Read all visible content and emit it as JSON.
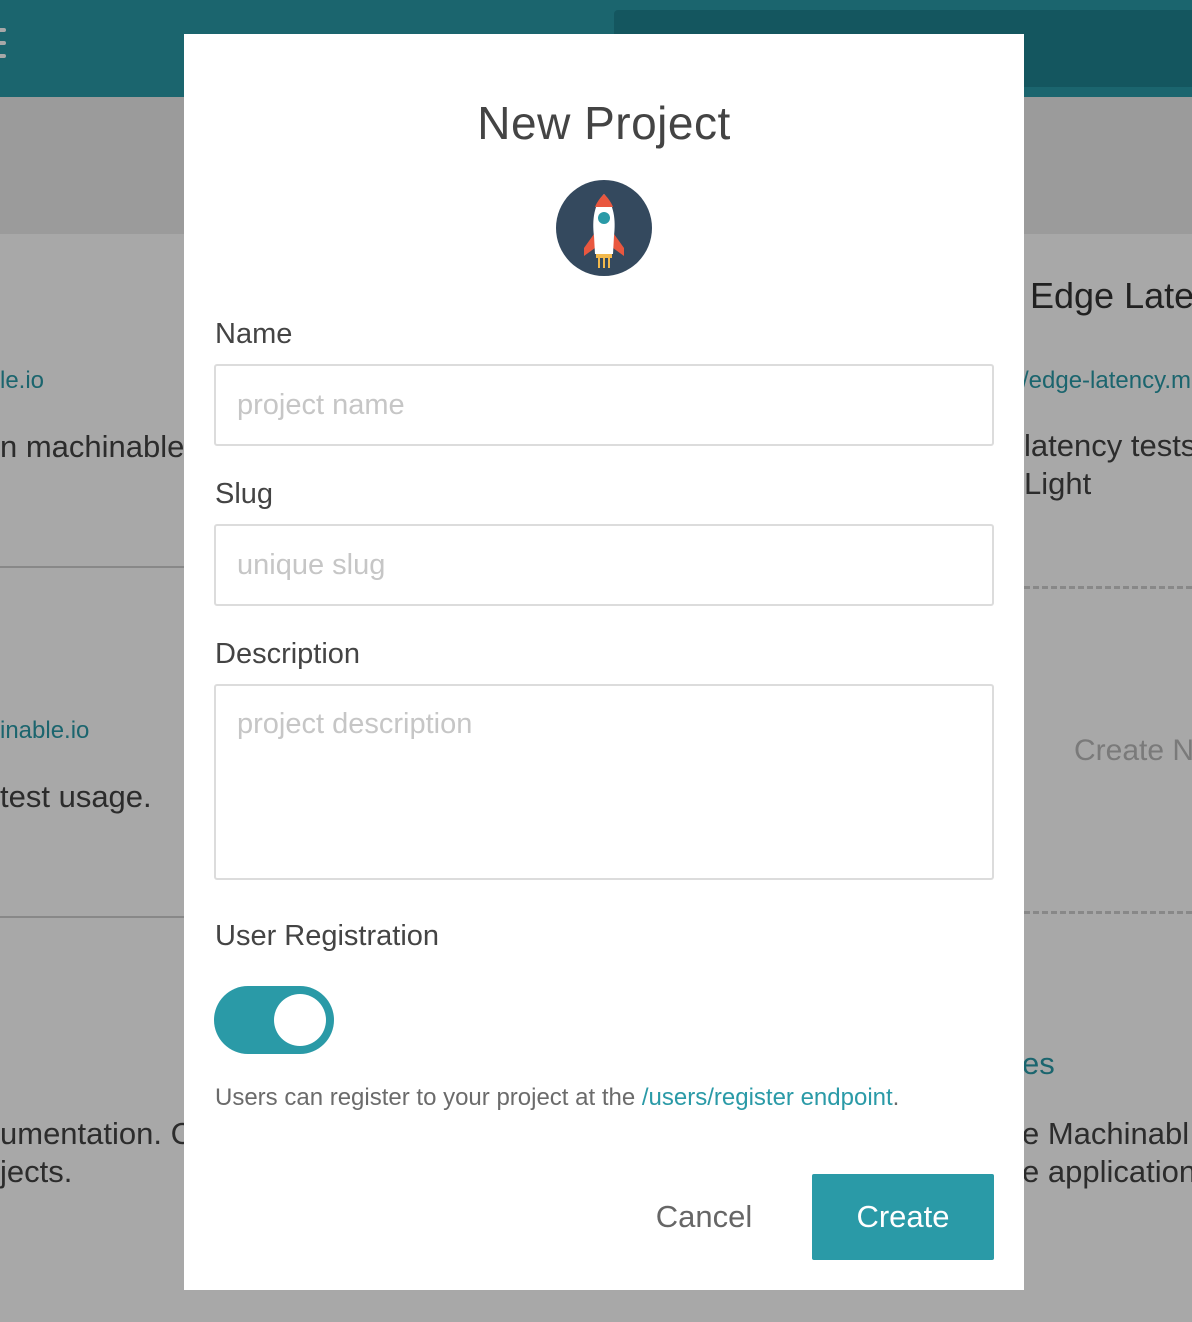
{
  "background": {
    "left_cards": [
      {
        "link": "le.io",
        "text": "n machinable"
      },
      {
        "link": "inable.io",
        "text": "test usage."
      }
    ],
    "right_card": {
      "title": "Edge Late",
      "link": "/edge-latency.m",
      "text_line1": "latency tests",
      "text_line2": "Light"
    },
    "create_new_label": "Create N",
    "bottom_left_line1": "umentation. C",
    "bottom_left_line2": "jects.",
    "bottom_right_heading": "es",
    "bottom_right_line1": "e Machinabl",
    "bottom_right_line2": "e application"
  },
  "modal": {
    "title": "New Project",
    "icon": "rocket-icon",
    "fields": {
      "name": {
        "label": "Name",
        "placeholder": "project name",
        "value": ""
      },
      "slug": {
        "label": "Slug",
        "placeholder": "unique slug",
        "value": ""
      },
      "description": {
        "label": "Description",
        "placeholder": "project description",
        "value": ""
      }
    },
    "user_registration": {
      "label": "User Registration",
      "enabled": true,
      "hint_prefix": "Users can register to your project at the ",
      "hint_link": "/users/register endpoint",
      "hint_suffix": "."
    },
    "buttons": {
      "cancel": "Cancel",
      "create": "Create"
    }
  },
  "colors": {
    "accent": "#2a9aa7",
    "rocket_bg": "#34495e",
    "rocket_fin": "#e9573f"
  }
}
